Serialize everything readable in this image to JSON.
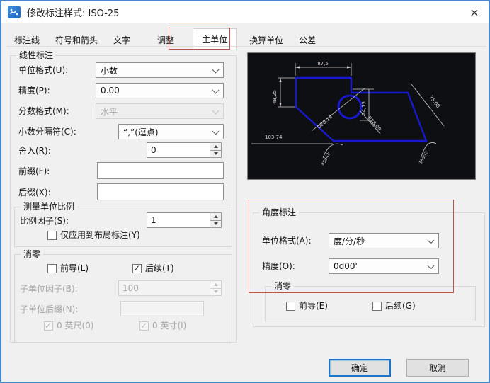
{
  "window": {
    "title": "修改标注样式: ISO-25",
    "close_glyph": "×"
  },
  "tabs": [
    {
      "label": "标注线",
      "active": false
    },
    {
      "label": "符号和箭头",
      "active": false
    },
    {
      "label": "文字",
      "active": false
    },
    {
      "label": "调整",
      "active": false
    },
    {
      "label": "主单位",
      "active": true
    },
    {
      "label": "换算单位",
      "active": false
    },
    {
      "label": "公差",
      "active": false
    }
  ],
  "linear": {
    "group_label": "线性标注",
    "unit_format": {
      "label": "单位格式(U):",
      "value": "小数"
    },
    "precision": {
      "label": "精度(P):",
      "value": "0.00"
    },
    "fraction_format": {
      "label": "分数格式(M):",
      "value": "水平",
      "disabled": true
    },
    "decimal_separator": {
      "label": "小数分隔符(C):",
      "value": "“,”(逗点)"
    },
    "round_off": {
      "label": "舍入(R):",
      "value": "0"
    },
    "prefix": {
      "label": "前缀(F):",
      "value": ""
    },
    "suffix": {
      "label": "后缀(X):",
      "value": ""
    },
    "measurement_scale": {
      "group_label": "测量单位比例",
      "scale_factor": {
        "label": "比例因子(S):",
        "value": "1"
      },
      "layout_only": {
        "label": "仅应用到布局标注(Y)",
        "checked": false
      }
    },
    "zero_suppression": {
      "group_label": "消零",
      "leading": {
        "label": "前导(L)",
        "checked": false
      },
      "trailing": {
        "label": "后续(T)",
        "checked": true
      },
      "sub_units_factor": {
        "label": "子单位因子(B):",
        "value": "100",
        "disabled": true
      },
      "sub_units_suffix": {
        "label": "子单位后缀(N):",
        "value": "",
        "disabled": true
      },
      "zero_feet": {
        "label": "0 英尺(0)",
        "checked": true,
        "disabled": true
      },
      "zero_inches": {
        "label": "0 英寸(I)",
        "checked": true,
        "disabled": true
      }
    }
  },
  "preview": {
    "dims": {
      "top": "87,5",
      "left": "48,25",
      "middle_vertical": "24,13",
      "right_diagonal": "75,08",
      "bottom_left": "103,74",
      "diameter": "Ø20,19",
      "radius": "R18,09",
      "angle_left": "45d42'",
      "angle_right": "38d02'"
    }
  },
  "angular": {
    "group_label": "角度标注",
    "unit_format": {
      "label": "单位格式(A):",
      "value": "度/分/秒"
    },
    "precision": {
      "label": "精度(O):",
      "value": "0d00'"
    },
    "zero_suppression": {
      "group_label": "消零",
      "leading": {
        "label": "前导(E)",
        "checked": false
      },
      "trailing": {
        "label": "后续(G)",
        "checked": false
      }
    }
  },
  "buttons": {
    "ok": "确定",
    "cancel": "取消"
  },
  "colors": {
    "dialog_border": "#4a86c8",
    "annotation_red": "#c0504d",
    "preview_background": "#0d0f13",
    "preview_shape_blue": "#1818cf",
    "focus_border": "#1a74c9"
  }
}
